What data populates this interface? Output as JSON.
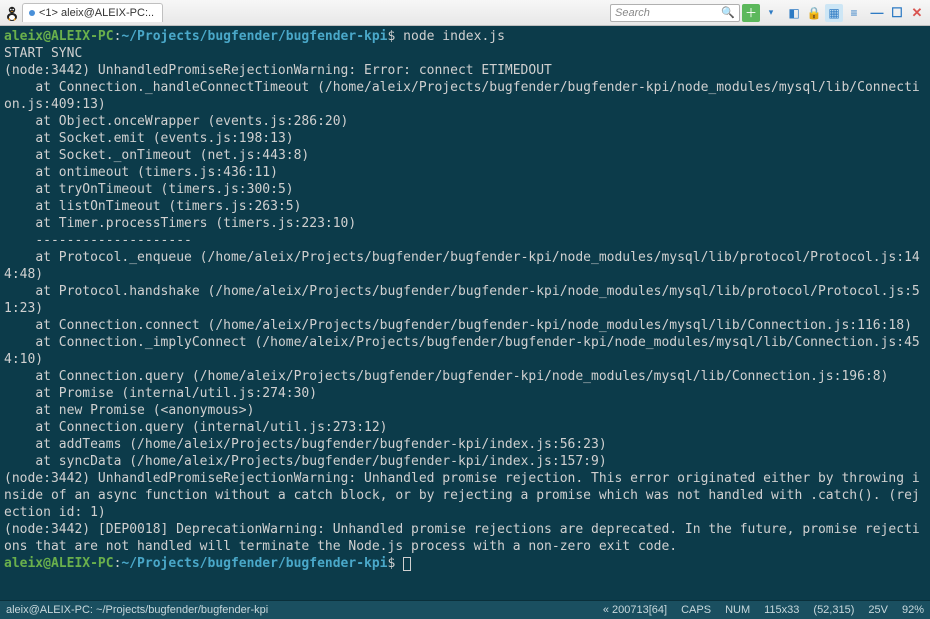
{
  "titlebar": {
    "tab_label": "<1> aleix@ALEIX-PC:..",
    "search_placeholder": "Search"
  },
  "prompt1": {
    "user_host": "aleix@ALEIX-PC",
    "colon": ":",
    "path": "~/Projects/bugfender/bugfender-kpi",
    "dollar": "$",
    "command": "node index.js"
  },
  "output": "START SYNC\n(node:3442) UnhandledPromiseRejectionWarning: Error: connect ETIMEDOUT\n    at Connection._handleConnectTimeout (/home/aleix/Projects/bugfender/bugfender-kpi/node_modules/mysql/lib/Connection.js:409:13)\n    at Object.onceWrapper (events.js:286:20)\n    at Socket.emit (events.js:198:13)\n    at Socket._onTimeout (net.js:443:8)\n    at ontimeout (timers.js:436:11)\n    at tryOnTimeout (timers.js:300:5)\n    at listOnTimeout (timers.js:263:5)\n    at Timer.processTimers (timers.js:223:10)\n    --------------------\n    at Protocol._enqueue (/home/aleix/Projects/bugfender/bugfender-kpi/node_modules/mysql/lib/protocol/Protocol.js:144:48)\n    at Protocol.handshake (/home/aleix/Projects/bugfender/bugfender-kpi/node_modules/mysql/lib/protocol/Protocol.js:51:23)\n    at Connection.connect (/home/aleix/Projects/bugfender/bugfender-kpi/node_modules/mysql/lib/Connection.js:116:18)\n    at Connection._implyConnect (/home/aleix/Projects/bugfender/bugfender-kpi/node_modules/mysql/lib/Connection.js:454:10)\n    at Connection.query (/home/aleix/Projects/bugfender/bugfender-kpi/node_modules/mysql/lib/Connection.js:196:8)\n    at Promise (internal/util.js:274:30)\n    at new Promise (<anonymous>)\n    at Connection.query (internal/util.js:273:12)\n    at addTeams (/home/aleix/Projects/bugfender/bugfender-kpi/index.js:56:23)\n    at syncData (/home/aleix/Projects/bugfender/bugfender-kpi/index.js:157:9)\n(node:3442) UnhandledPromiseRejectionWarning: Unhandled promise rejection. This error originated either by throwing inside of an async function without a catch block, or by rejecting a promise which was not handled with .catch(). (rejection id: 1)\n(node:3442) [DEP0018] DeprecationWarning: Unhandled promise rejections are deprecated. In the future, promise rejections that are not handled will terminate the Node.js process with a non-zero exit code.",
  "prompt2": {
    "user_host": "aleix@ALEIX-PC",
    "colon": ":",
    "path": "~/Projects/bugfender/bugfender-kpi",
    "dollar": "$"
  },
  "statusbar": {
    "left": "aleix@ALEIX-PC: ~/Projects/bugfender/bugfender-kpi",
    "encoding": "« 200713[64]",
    "caps": "CAPS",
    "num": "NUM",
    "size": "115x33",
    "pos": "(52,315)",
    "vol": "25V",
    "pct": "92%"
  }
}
